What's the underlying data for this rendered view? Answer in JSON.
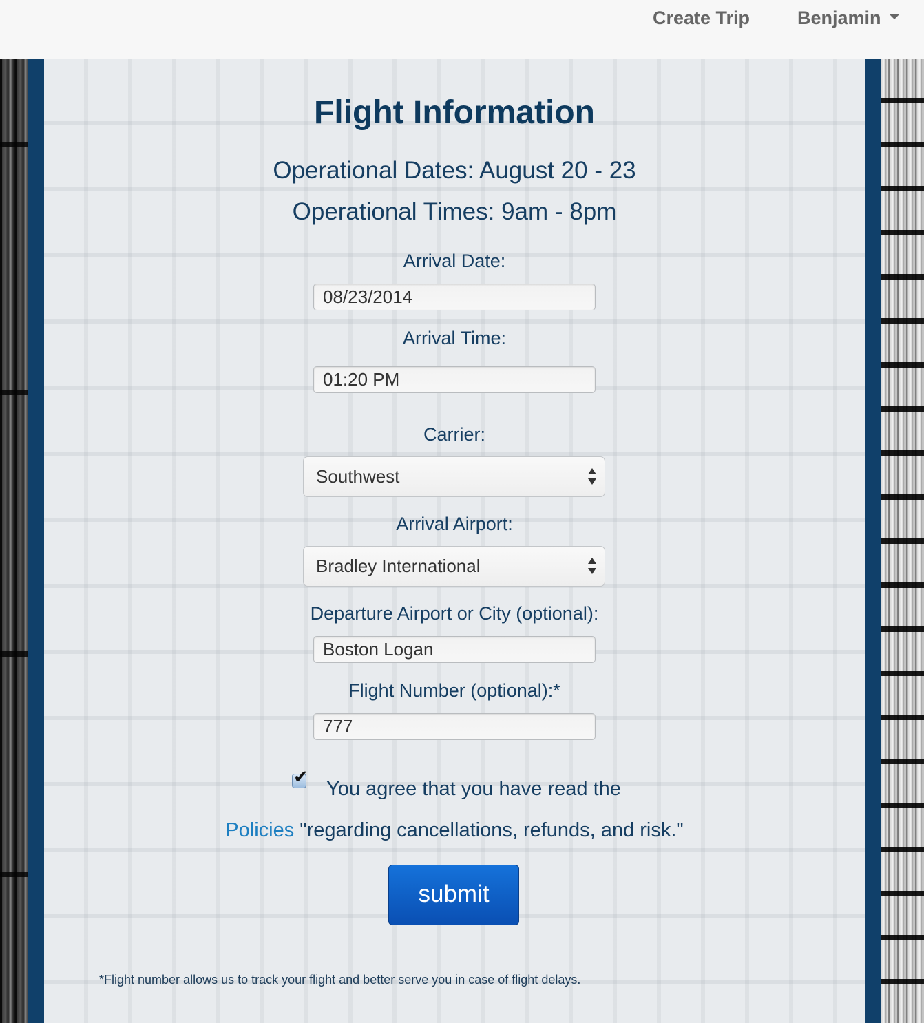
{
  "navbar": {
    "create_trip": "Create Trip",
    "user_name": "Benjamin"
  },
  "form": {
    "title": "Flight Information",
    "operational_dates": "Operational Dates: August 20 - 23",
    "operational_times": "Operational Times: 9am - 8pm",
    "arrival_date": {
      "label": "Arrival Date:",
      "value": "08/23/2014"
    },
    "arrival_time": {
      "label": "Arrival Time:",
      "value": "01:20 PM"
    },
    "carrier": {
      "label": "Carrier:",
      "selected": "Southwest"
    },
    "arrival_airport": {
      "label": "Arrival Airport:",
      "selected": "Bradley International"
    },
    "departure": {
      "label": "Departure Airport or City (optional):",
      "value": "Boston Logan"
    },
    "flight_number": {
      "label": "Flight Number (optional):*",
      "value": "777"
    },
    "agree": {
      "checked": true,
      "text_line1": "You agree that you have read the",
      "policies_link": "Policies",
      "text_line2": " \"regarding cancellations, refunds, and risk.\""
    },
    "submit_label": "submit",
    "footnote": "*Flight number allows us to track your flight and better serve you in case of flight delays."
  },
  "colors": {
    "navbar_bg": "#f7f7f7",
    "frame_blue": "#10406a",
    "heading_blue": "#0e3a5e",
    "link_blue": "#1d7fc1",
    "submit_blue": "#0a4fb3"
  }
}
